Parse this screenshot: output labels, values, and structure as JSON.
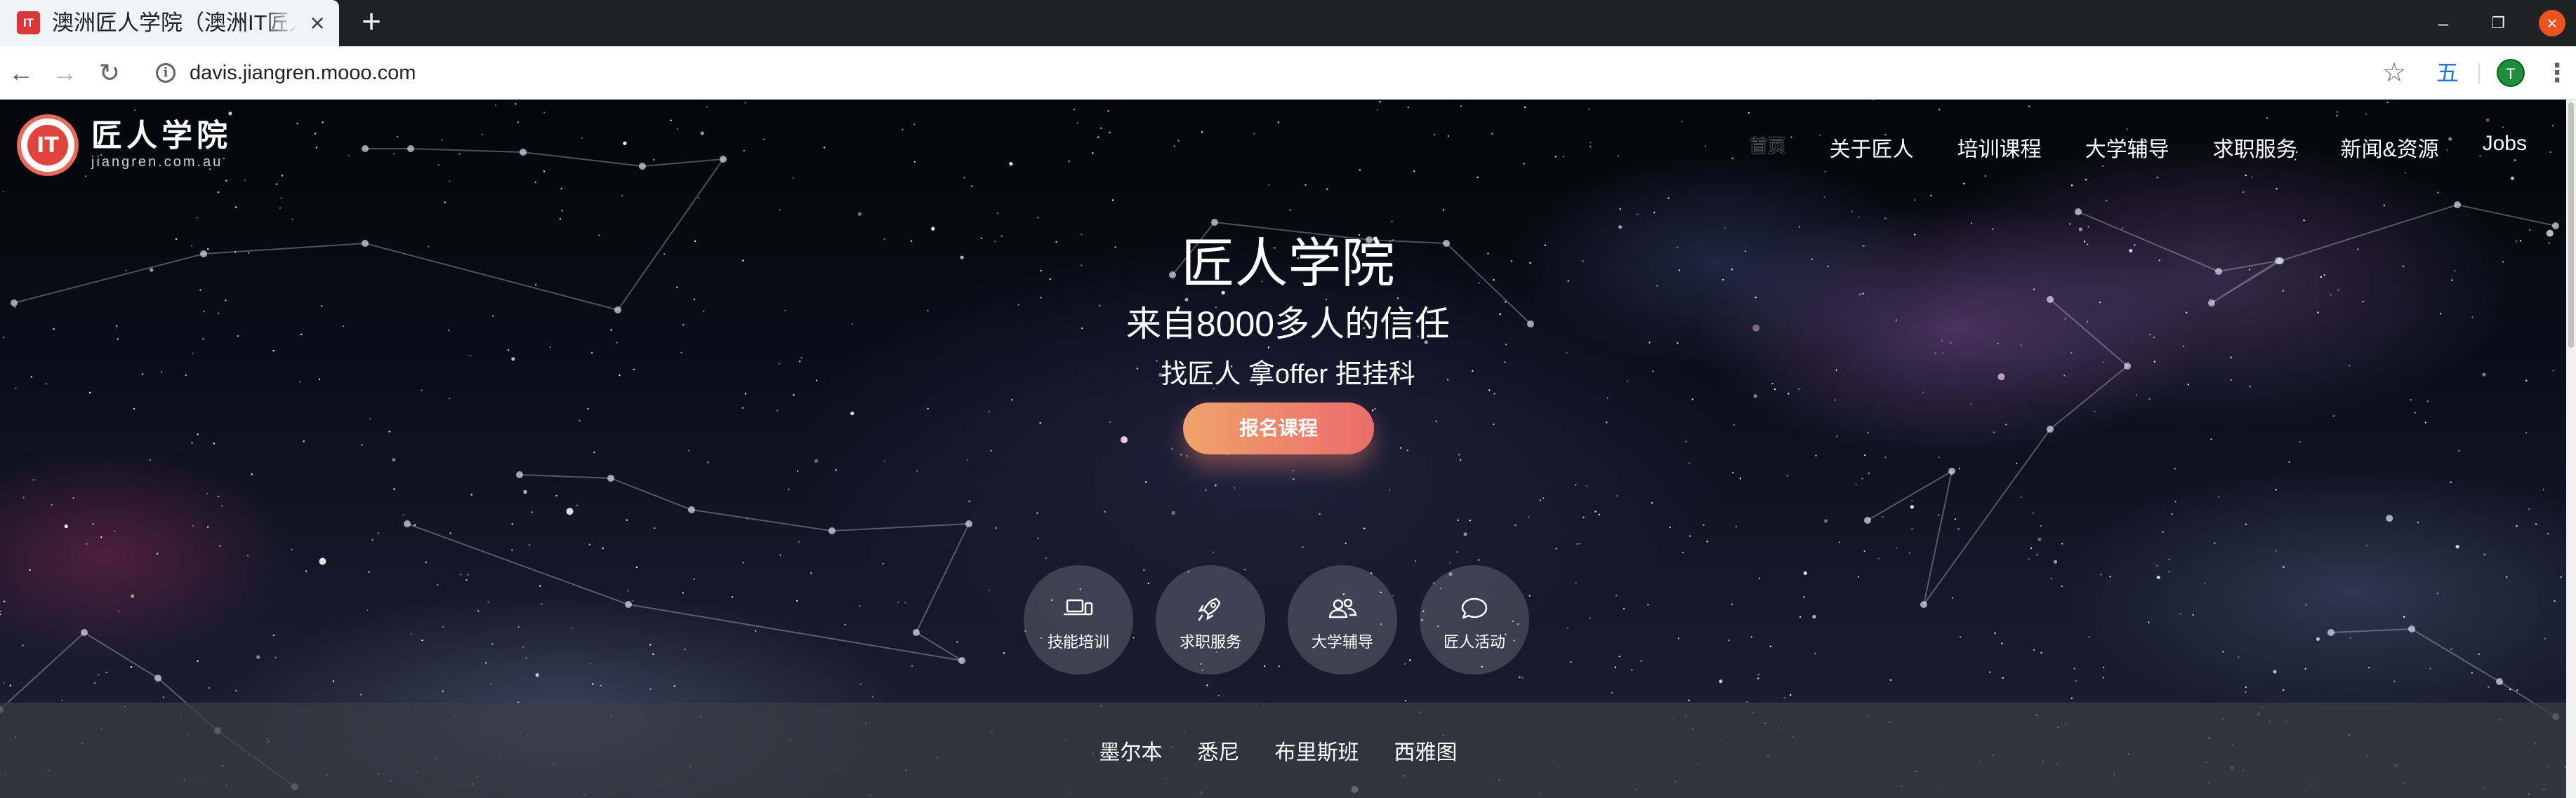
{
  "browser": {
    "tab_title": "澳洲匠人学院（澳洲IT匠人",
    "favicon_text": "IT",
    "url": "davis.jiangren.mooo.com",
    "extension_label": "五",
    "profile_initial": "T"
  },
  "site": {
    "logo_mark": "IT",
    "logo_name": "匠人学院",
    "logo_domain": "jiangren.com.au"
  },
  "nav": {
    "home": "首页",
    "items": [
      "关于匠人",
      "培训课程",
      "大学辅导",
      "求职服务",
      "新闻&资源",
      "Jobs"
    ]
  },
  "hero": {
    "title": "匠人学院",
    "subtitle": "来自8000多人的信任",
    "slogan": "找匠人 拿offer 拒挂科",
    "cta_label": "报名课程"
  },
  "services": [
    {
      "label": "技能培训",
      "icon": "laptop-icon"
    },
    {
      "label": "求职服务",
      "icon": "rocket-icon"
    },
    {
      "label": "大学辅导",
      "icon": "users-icon"
    },
    {
      "label": "匠人活动",
      "icon": "chat-icon"
    }
  ],
  "cities": [
    "墨尔本",
    "悉尼",
    "布里斯班",
    "西雅图"
  ],
  "colors": {
    "cta_start": "#f0a26a",
    "cta_end": "#ea6c6c",
    "logo_red": "#e0443c"
  }
}
